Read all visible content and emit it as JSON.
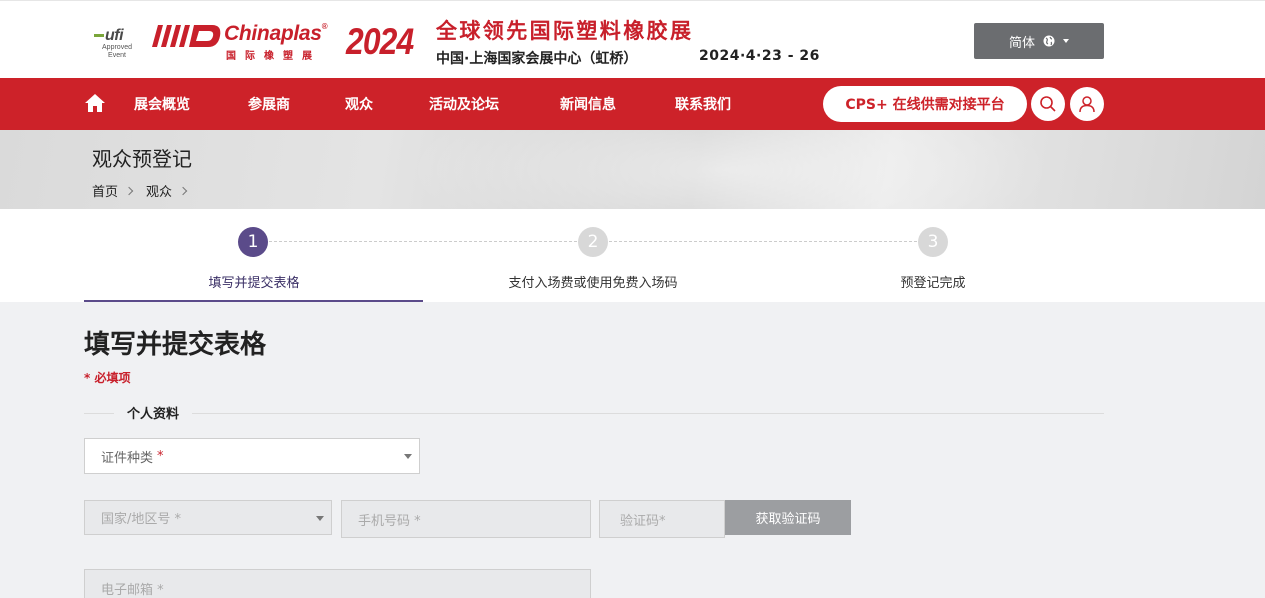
{
  "header": {
    "ufi_mark": "ufi",
    "ufi_sub": "Approved Event",
    "brand_name": "Chinaplas",
    "brand_cn": "国际橡塑展",
    "brand_year": "2024",
    "slogan": "全球领先国际塑料橡胶展",
    "venue": "中国·上海国家会展中心（虹桥）",
    "dates": "2024·4·23 - 26",
    "language": {
      "label": "简体",
      "icon": "globe-icon"
    }
  },
  "nav": {
    "items": [
      {
        "label": "展会概览"
      },
      {
        "label": "参展商"
      },
      {
        "label": "观众"
      },
      {
        "label": "活动及论坛"
      },
      {
        "label": "新闻信息"
      },
      {
        "label": "联系我们"
      }
    ],
    "cps_button": "CPS+ 在线供需对接平台",
    "icons": [
      "home-icon",
      "search-icon",
      "user-icon"
    ]
  },
  "banner": {
    "title": "观众预登记",
    "breadcrumb": [
      "首页",
      "观众"
    ]
  },
  "stepper": {
    "steps": [
      {
        "number": "1",
        "label": "填写并提交表格",
        "active": true
      },
      {
        "number": "2",
        "label": "支付入场费或使用免费入场码",
        "active": false
      },
      {
        "number": "3",
        "label": "预登记完成",
        "active": false
      }
    ]
  },
  "form": {
    "title": "填写并提交表格",
    "required_note": "* 必填项",
    "section": "个人资料",
    "id_type": {
      "placeholder": "证件种类",
      "required_mark": "*"
    },
    "country_code": {
      "placeholder": "国家/地区号 *"
    },
    "mobile": {
      "placeholder": "手机号码 *"
    },
    "code": {
      "placeholder": "验证码*"
    },
    "get_code_button": "获取验证码",
    "email": {
      "placeholder": "电子邮箱 *"
    }
  },
  "colors": {
    "brand_red": "#cd2229",
    "step_active": "#5b4b8a",
    "lang_bg": "#6b6d70",
    "button_grey": "#9c9ea1"
  }
}
